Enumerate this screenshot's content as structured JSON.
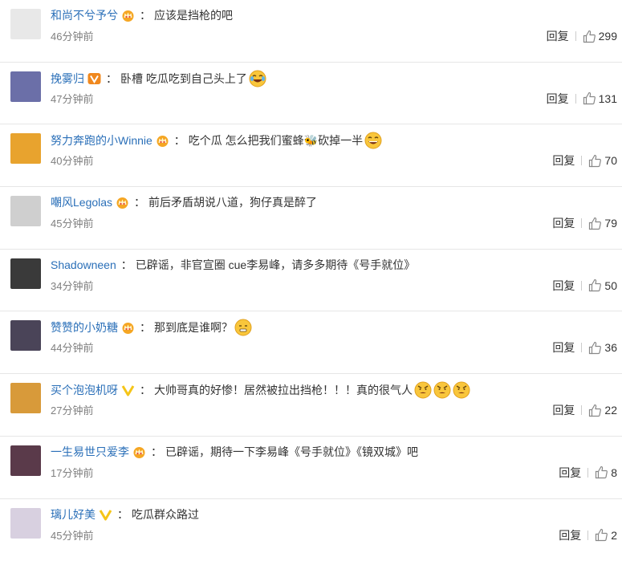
{
  "comments": [
    {
      "user": "和尚不兮予兮",
      "badge": "crown",
      "text": "应该是挡枪的吧",
      "emojis": [],
      "time": "46分钟前",
      "reply": "回复",
      "likes": "299",
      "avatar_color": "#e8e8e8"
    },
    {
      "user": "挽雾归",
      "badge": "v-orange",
      "text": "卧槽 吃瓜吃到自己头上了",
      "emojis": [
        "laugh-cry"
      ],
      "time": "47分钟前",
      "reply": "回复",
      "likes": "131",
      "avatar_color": "#6b6fa8"
    },
    {
      "user": "努力奔跑的小Winnie",
      "badge": "crown",
      "text": "吃个瓜 怎么把我们蜜蜂🐝砍掉一半",
      "emojis": [
        "laugh"
      ],
      "time": "40分钟前",
      "reply": "回复",
      "likes": "70",
      "avatar_color": "#e8a32e"
    },
    {
      "user": "嘲风Legolas",
      "badge": "crown",
      "text": "前后矛盾胡说八道，狗仔真是醉了",
      "emojis": [],
      "time": "45分钟前",
      "reply": "回复",
      "likes": "79",
      "avatar_color": "#cfcfcf"
    },
    {
      "user": "Shadowneen",
      "badge": "none",
      "text": "已辟谣，非官宣圈 cue李易峰，请多多期待《号手就位》",
      "emojis": [],
      "time": "34分钟前",
      "reply": "回复",
      "likes": "50",
      "avatar_color": "#3a3a3a"
    },
    {
      "user": "赞赞的小奶糖",
      "badge": "crown",
      "text": "那到底是谁啊？",
      "emojis": [
        "shush"
      ],
      "time": "44分钟前",
      "reply": "回复",
      "likes": "36",
      "avatar_color": "#4a4458"
    },
    {
      "user": "买个泡泡机呀",
      "badge": "v-yellow",
      "text": "大帅哥真的好惨！居然被拉出挡枪！！！真的很气人",
      "emojis": [
        "angry",
        "angry",
        "angry"
      ],
      "time": "27分钟前",
      "reply": "回复",
      "likes": "22",
      "avatar_color": "#d89a3a"
    },
    {
      "user": "一生易世只爱李",
      "badge": "crown",
      "text": "已辟谣，期待一下李易峰《号手就位》《镜双城》吧",
      "emojis": [],
      "time": "17分钟前",
      "reply": "回复",
      "likes": "8",
      "avatar_color": "#5a3a4a"
    },
    {
      "user": "璃儿好美",
      "badge": "v-yellow",
      "text": "吃瓜群众路过",
      "emojis": [],
      "time": "45分钟前",
      "reply": "回复",
      "likes": "2",
      "avatar_color": "#d8d0e0"
    }
  ],
  "colors": {
    "username": "#2a6fb8",
    "text": "#333333",
    "time": "#808080",
    "divider": "#e6e6e6",
    "crown": "#f5a623",
    "v_orange": "#f0881e",
    "v_yellow": "#f5c518"
  }
}
